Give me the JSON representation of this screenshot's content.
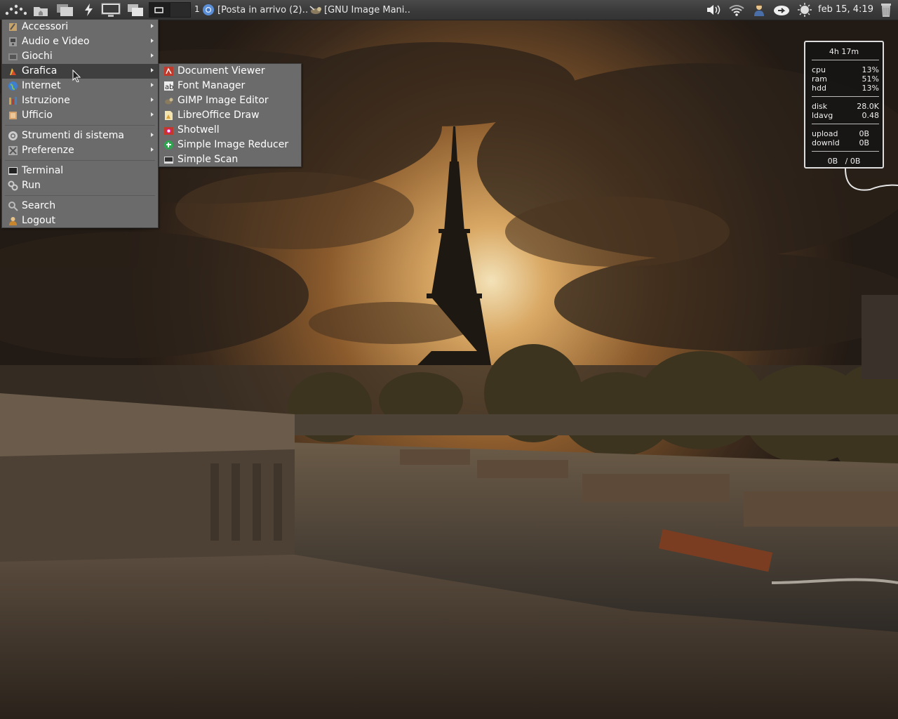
{
  "panel": {
    "workspace_number": "1",
    "tasks": [
      {
        "label": "[Posta in arrivo (2)…",
        "icon": "chromium-icon"
      },
      {
        "label": "[GNU Image Mani…",
        "icon": "gimp-icon"
      }
    ],
    "clock": "feb 15,  4:19",
    "tray_icons": [
      "volume-icon",
      "wifi-icon",
      "user-icon",
      "dropbox-icon",
      "weather-icon",
      "trash-icon"
    ]
  },
  "main_menu": {
    "items": [
      {
        "label": "Accessori",
        "icon": "accessories-icon",
        "submenu": true
      },
      {
        "label": "Audio e Video",
        "icon": "multimedia-icon",
        "submenu": true
      },
      {
        "label": "Giochi",
        "icon": "games-icon",
        "submenu": true
      },
      {
        "label": "Grafica",
        "icon": "graphics-icon",
        "submenu": true,
        "highlighted": true
      },
      {
        "label": "Internet",
        "icon": "internet-icon",
        "submenu": true
      },
      {
        "label": "Istruzione",
        "icon": "education-icon",
        "submenu": true
      },
      {
        "label": "Ufficio",
        "icon": "office-icon",
        "submenu": true
      },
      {
        "label": "Strumenti di sistema",
        "icon": "system-tools-icon",
        "submenu": true
      },
      {
        "label": "Preferenze",
        "icon": "preferences-icon",
        "submenu": true
      },
      {
        "label": "Terminal",
        "icon": "terminal-icon",
        "submenu": false
      },
      {
        "label": "Run",
        "icon": "run-icon",
        "submenu": false
      },
      {
        "label": "Search",
        "icon": "search-icon",
        "submenu": false
      },
      {
        "label": "Logout",
        "icon": "logout-icon",
        "submenu": false
      }
    ]
  },
  "submenu_grafica": {
    "items": [
      {
        "label": "Document Viewer",
        "icon": "document-viewer-icon"
      },
      {
        "label": "Font Manager",
        "icon": "font-manager-icon"
      },
      {
        "label": "GIMP Image Editor",
        "icon": "gimp-icon"
      },
      {
        "label": "LibreOffice Draw",
        "icon": "libreoffice-draw-icon"
      },
      {
        "label": "Shotwell",
        "icon": "shotwell-icon"
      },
      {
        "label": "Simple Image Reducer",
        "icon": "image-reducer-icon"
      },
      {
        "label": "Simple Scan",
        "icon": "scanner-icon"
      }
    ]
  },
  "conky": {
    "uptime": "4h 17m",
    "stats": [
      {
        "key": "cpu",
        "value": "13%"
      },
      {
        "key": "ram",
        "value": "51%"
      },
      {
        "key": "hdd",
        "value": "13%"
      }
    ],
    "disk": [
      {
        "key": "disk",
        "value": "28.0K"
      },
      {
        "key": "ldavg",
        "value": "0.48"
      }
    ],
    "net": [
      {
        "key": "upload",
        "value": "0B"
      },
      {
        "key": "downld",
        "value": "0B"
      }
    ],
    "total": "0B   / 0B"
  }
}
